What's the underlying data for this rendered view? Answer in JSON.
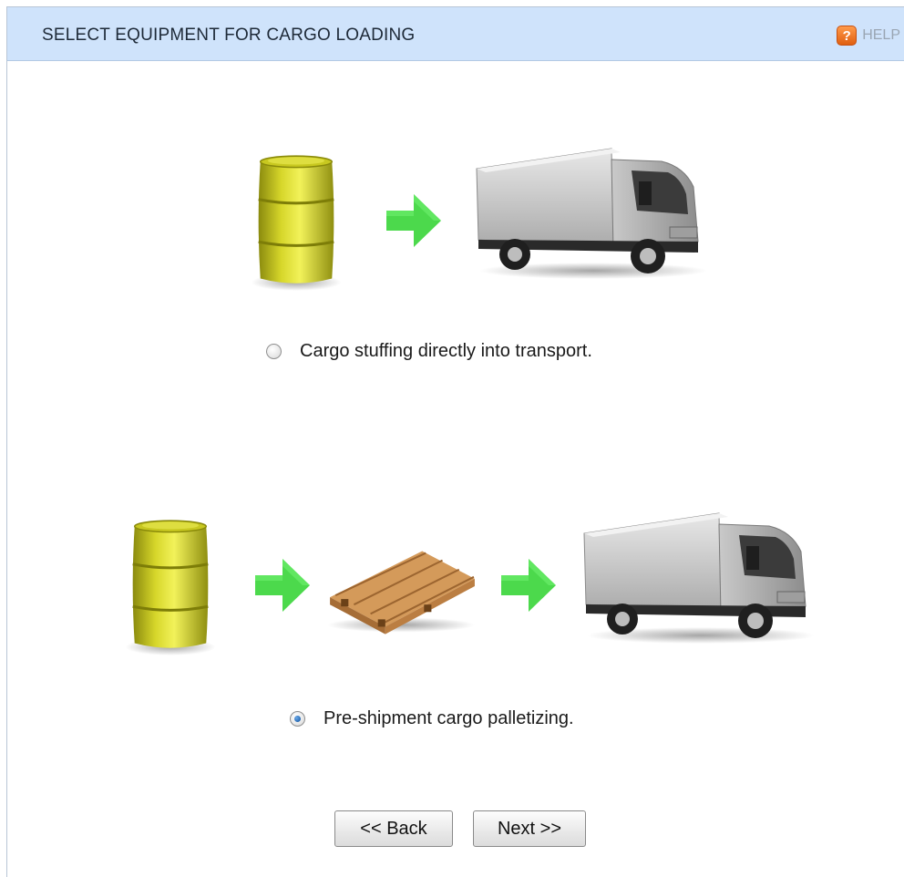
{
  "header": {
    "title": "SELECT EQUIPMENT FOR CARGO LOADING",
    "help_badge": "?",
    "help_label": "HELP"
  },
  "options": [
    {
      "label": "Cargo stuffing directly into transport.",
      "checked": false,
      "illustration": [
        "barrel-icon",
        "arrow-right-icon",
        "truck-icon"
      ]
    },
    {
      "label": "Pre-shipment cargo palletizing.",
      "checked": true,
      "illustration": [
        "barrel-icon",
        "arrow-right-icon",
        "pallet-icon",
        "arrow-right-icon",
        "truck-icon"
      ]
    }
  ],
  "buttons": {
    "back_label": "<< Back",
    "next_label": "Next >>"
  },
  "colors": {
    "header_bg": "#cfe3fb",
    "arrow": "#4cd94c",
    "barrel": "#b8b81a",
    "help_badge": "#f07a2a"
  }
}
